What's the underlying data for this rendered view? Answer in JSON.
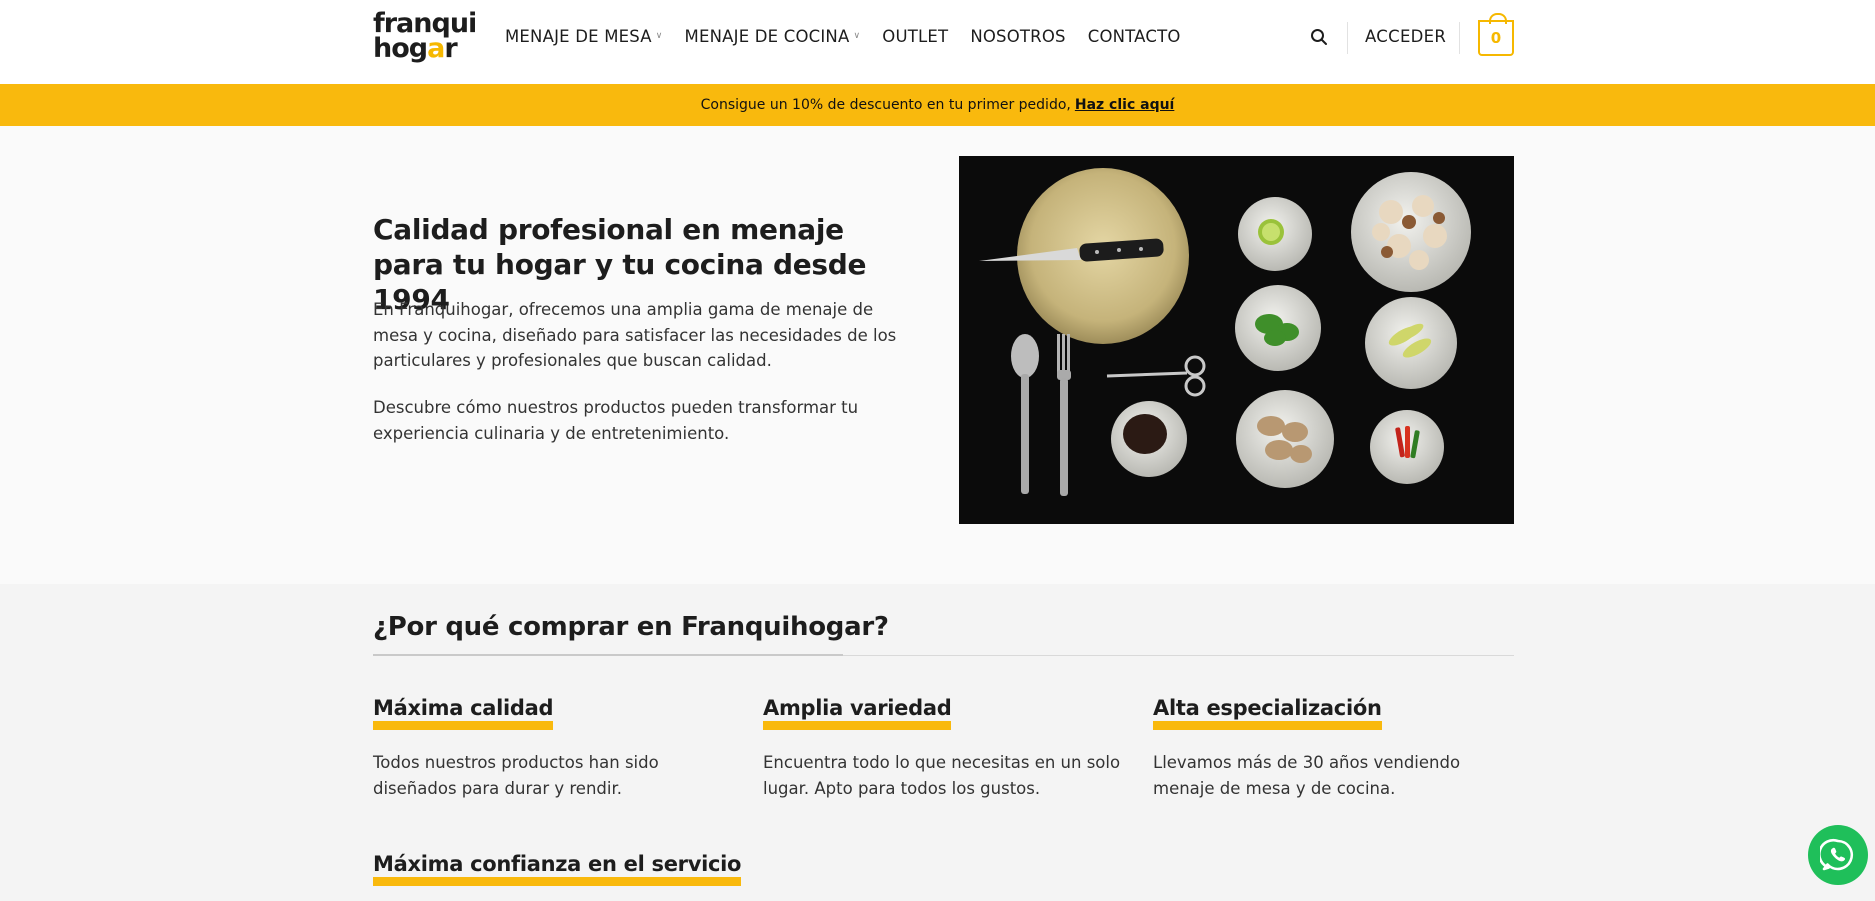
{
  "logo": {
    "line1": "franqui",
    "line2_a": "hog",
    "line2_house": "a",
    "line2_b": "r"
  },
  "nav": {
    "items": [
      {
        "label": "MENAJE DE MESA",
        "dropdown": true
      },
      {
        "label": "MENAJE DE COCINA",
        "dropdown": true
      },
      {
        "label": "OUTLET",
        "dropdown": false
      },
      {
        "label": "NOSOTROS",
        "dropdown": false
      },
      {
        "label": "CONTACTO",
        "dropdown": false
      }
    ]
  },
  "header": {
    "login_label": "ACCEDER",
    "cart_count": "0",
    "search_icon": "search-icon"
  },
  "promo": {
    "text": "Consigue un 10% de descuento en tu primer pedido,",
    "link": "Haz clic aquí",
    "color": "#f9b90d"
  },
  "hero": {
    "title": "Calidad profesional en menaje para tu hogar y tu cocina desde 1994",
    "p1": "En Franquihogar, ofrecemos una amplia gama de menaje de mesa y cocina, diseñado para satisfacer las necesidades de los particulares y profesionales que buscan calidad.",
    "p2": "Descubre cómo nuestros productos pueden transformar tu experiencia culinaria y de entretenimiento."
  },
  "why": {
    "title": "¿Por qué comprar en Franquihogar?",
    "features": [
      {
        "title": "Máxima calidad",
        "desc": "Todos nuestros productos han sido diseñados para durar y rendir."
      },
      {
        "title": "Amplia variedad",
        "desc": "Encuentra todo lo que necesitas en un solo lugar. Apto para todos los gustos."
      },
      {
        "title": "Alta especialización",
        "desc": "Llevamos más de 30 años vendiendo menaje de mesa y de cocina."
      },
      {
        "title": "Máxima confianza en el servicio",
        "desc": ""
      }
    ]
  },
  "colors": {
    "accent": "#f9b90d",
    "whatsapp": "#1fbf5a"
  }
}
